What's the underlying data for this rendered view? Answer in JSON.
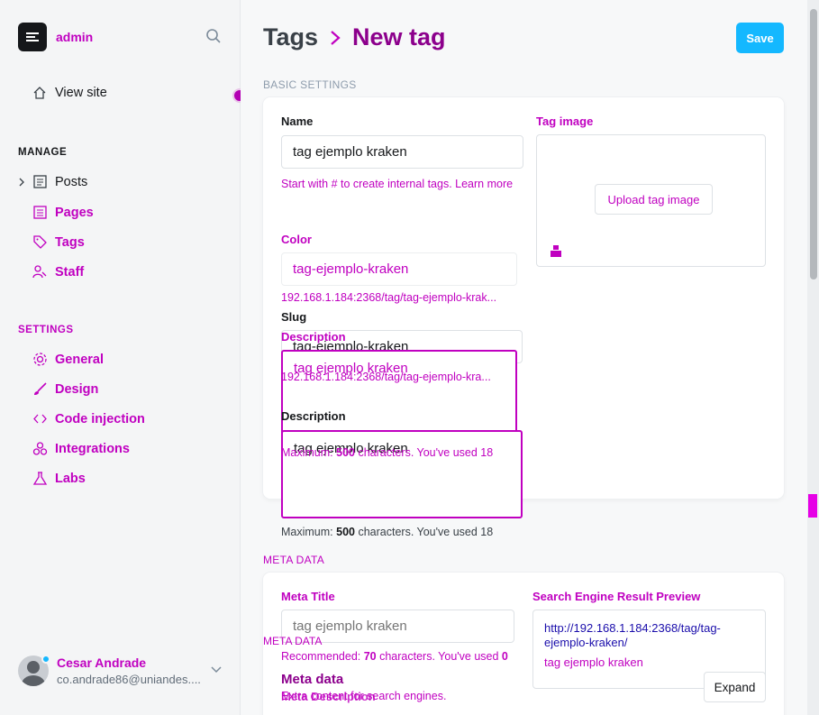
{
  "sidebar": {
    "brand": "admin",
    "view_site": "View site",
    "manage_label": "MANAGE",
    "manage_items": [
      "Posts",
      "Pages",
      "Tags",
      "Staff"
    ],
    "settings_label": "SETTINGS",
    "settings_items": [
      "General",
      "Design",
      "Code injection",
      "Integrations",
      "Labs"
    ],
    "user_name": "Cesar Andrade",
    "user_email": "co.andrade86@uniandes...."
  },
  "header": {
    "parent": "Tags",
    "current": "New tag",
    "save_label": "Save"
  },
  "basic": {
    "section_label": "BASIC SETTINGS",
    "name_label": "Name",
    "name_value": "tag ejemplo kraken",
    "name_help": "Start with # to create internal tags. Learn more",
    "color_label": "Color",
    "color_value": "tag-ejemplo-kraken",
    "slug_url_1": "192.168.1.184:2368/tag/tag-ejemplo-krak...",
    "slug_label": "Slug",
    "slug_value": "tag-ejemplo-kraken",
    "slug_url_2": "192.168.1.184:2368/tag/tag-ejemplo-kra...",
    "description_label": "Description",
    "description_value": "tag ejemplo kraken",
    "description_help_prefix": "Maximum: ",
    "description_max": "500",
    "description_help_suffix": " characters. You've used 18",
    "tag_image_label": "Tag image",
    "upload_label": "Upload tag image"
  },
  "meta": {
    "section_label": "META DATA",
    "meta_title_label": "Meta Title",
    "meta_title_placeholder": "tag ejemplo kraken",
    "meta_title_help_prefix": "Recommended: ",
    "meta_title_recommended": "70",
    "meta_title_help_suffix": " characters. You've used ",
    "meta_title_used": "0",
    "overlay_section": "META DATA",
    "overlay_title": "Meta data",
    "overlay_desc": "Extra content for search engines.",
    "meta_description_label": "Meta Description",
    "serp_label": "Search Engine Result Preview",
    "serp_url": "http://192.168.1.184:2368/tag/tag-ejemplo-kraken/",
    "serp_title": "tag ejemplo kraken",
    "expand_label": "Expand"
  },
  "colors": {
    "accent": "#14b8ff",
    "overlay": "#c000c0"
  }
}
